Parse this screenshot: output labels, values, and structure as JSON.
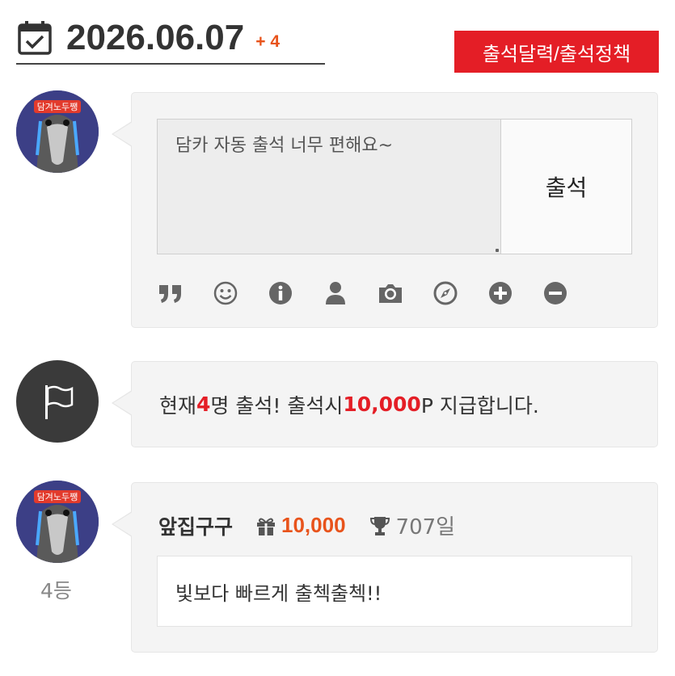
{
  "header": {
    "date": "2026.06.07",
    "plus": "+ 4",
    "policy_button": "출석달력/출석정책"
  },
  "compose": {
    "textarea_value": "담카 자동 출석 너무 편해요~",
    "submit_label": "출석",
    "toolbar_icons": [
      "quote-icon",
      "smile-icon",
      "info-icon",
      "user-icon",
      "camera-icon",
      "compass-icon",
      "plus-circle-icon",
      "minus-circle-icon"
    ]
  },
  "notice": {
    "prefix": "현재 ",
    "count": "4",
    "middle": "명 출석! 출석시 ",
    "points": "10,000",
    "suffix": "P 지급합니다."
  },
  "entry": {
    "user_name": "앞집구구",
    "points": "10,000",
    "days": "707일",
    "comment": "빛보다 빠르게 출첵출첵!!",
    "rank": "4등"
  },
  "colors": {
    "accent_red": "#e41e26",
    "accent_orange": "#e8531b"
  }
}
